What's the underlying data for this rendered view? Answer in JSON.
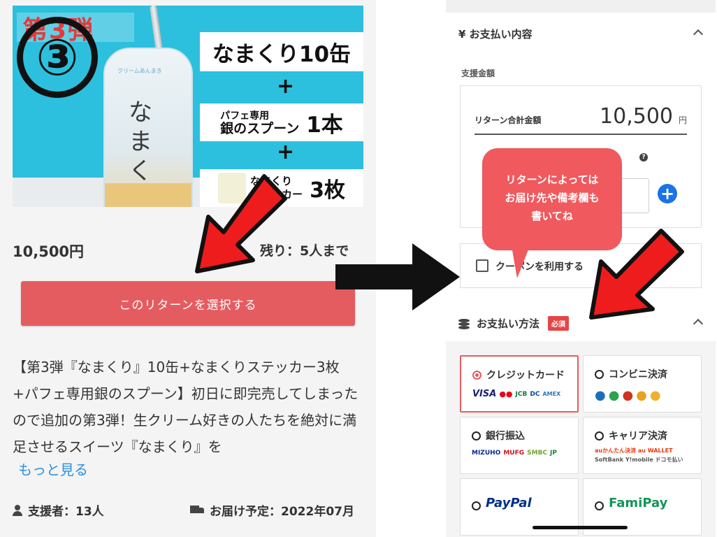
{
  "left": {
    "hero": {
      "ribbon": "第3弾",
      "number": "③",
      "jar_text": "なまくり",
      "jar_small": "クリームあんまき",
      "line1": "なまくり10缶",
      "plus": "+",
      "line2_small_a": "パフェ専用",
      "line2_small_b": "銀のスプーン",
      "line2_big": "1本",
      "line3_small_a": "なまくり",
      "line3_small_b": "ステッカー",
      "line3_big": "3枚"
    },
    "price": "10,500円",
    "remaining": "残り：5人まで",
    "select_button": "このリターンを選択する",
    "description": "【第3弾『なまくり』10缶+なまくりステッカー3枚+パフェ専用銀のスプーン】初日に即完売してしまったので追加の第3弾！生クリーム好きの人たちを絶対に満足させるスイーツ『なまくり』を",
    "more_link": "もっと見る",
    "backers": "支援者：13人",
    "delivery": "お届け予定：2022年07月"
  },
  "right": {
    "payment_content_title": "¥  お支払い内容",
    "support_amount_label": "支援金額",
    "return_total_label": "リターン合計金額",
    "return_total_value": "10,500",
    "yen_unit": "円",
    "help_mark": "?",
    "plus_button": "+",
    "coupon_label": "クーポンを利用する",
    "payment_method_title": "お支払い方法",
    "required_badge": "必須",
    "methods": {
      "credit": {
        "label": "クレジットカード",
        "logos": [
          "VISA",
          "●●",
          "JCB",
          "DC",
          "AMEX"
        ]
      },
      "convenience": {
        "label": "コンビニ決済",
        "logos": [
          "●",
          "●",
          "●",
          "●",
          "●"
        ]
      },
      "bank": {
        "label": "銀行振込",
        "logos": [
          "MIZUHO",
          "MUFG",
          "SMBC",
          "JP"
        ]
      },
      "carrier": {
        "label": "キャリア決済",
        "logos": [
          "auかんたん決済 au WALLET",
          "SoftBank Y!mobile ドコモ払い"
        ]
      },
      "paypal": {
        "label": "PayPal"
      },
      "famipay": {
        "label": "FamiPay"
      }
    }
  },
  "bubble": {
    "line1": "リターンによっては",
    "line2": "お届け先や備考欄も",
    "line3": "書いてね"
  },
  "colors": {
    "accent_red": "#e55c60",
    "link_blue": "#2a8fe0",
    "arrow_red": "#ee1c1c",
    "plus_blue": "#1a73e8"
  }
}
